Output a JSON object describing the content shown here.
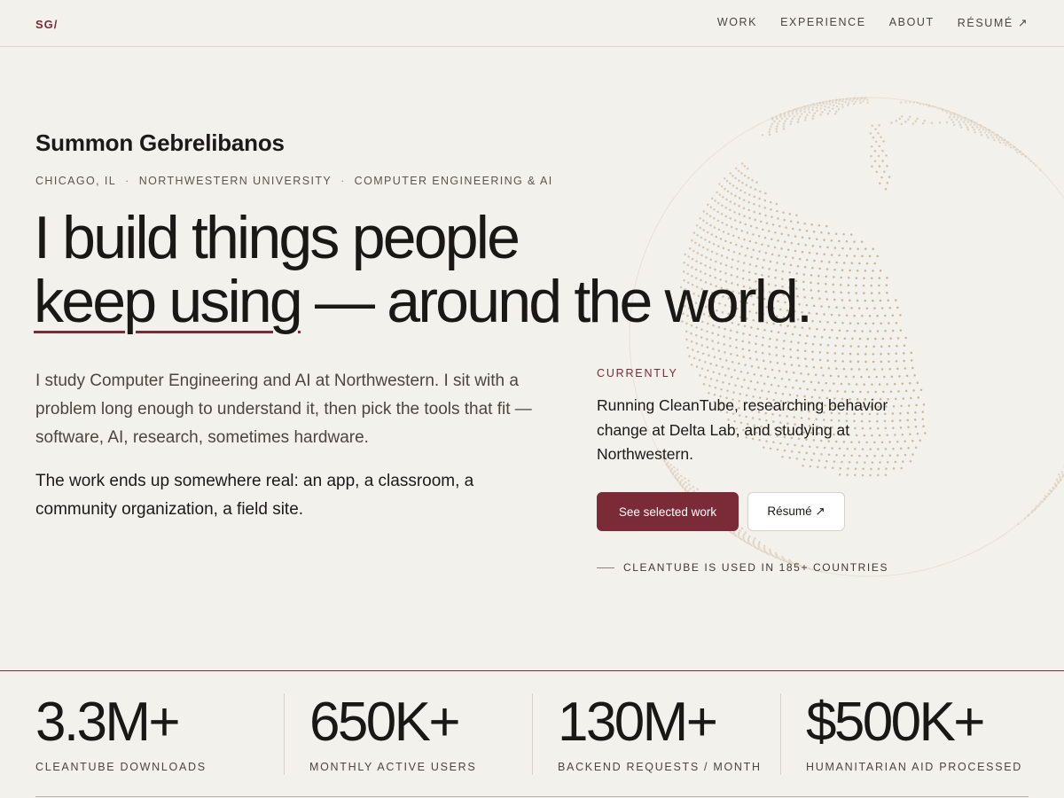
{
  "header": {
    "logo": "SG/",
    "nav": [
      {
        "label": "WORK"
      },
      {
        "label": "EXPERIENCE"
      },
      {
        "label": "ABOUT"
      },
      {
        "label": "RÉSUMÉ ↗"
      }
    ]
  },
  "hero": {
    "name": "Summon Gebrelibanos",
    "meta": [
      "CHICAGO, IL",
      "NORTHWESTERN UNIVERSITY",
      "COMPUTER ENGINEERING & AI"
    ],
    "meta_separator": "·",
    "headline_line1": "I build things people",
    "headline_underlined": "keep using",
    "headline_rest": " — around the world.",
    "intro": "I study Computer Engineering and AI at Northwestern. I sit with a problem long enough to understand it, then pick the tools that fit — software, AI, research, sometimes hardware.",
    "intro2": "The work ends up somewhere real: an app, a classroom, a community organization, a field site."
  },
  "currently": {
    "label": "CURRENTLY",
    "text": "Running CleanTube, researching behavior change at Delta Lab, and studying at Northwestern.",
    "primary_button": "See selected work",
    "secondary_button": "Résumé ↗",
    "footnote": "CLEANTUBE IS USED IN 185+ COUNTRIES"
  },
  "stats": [
    {
      "value": "3.3M+",
      "label": "CLEANTUBE DOWNLOADS"
    },
    {
      "value": "650K+",
      "label": "MONTHLY ACTIVE USERS"
    },
    {
      "value": "130M+",
      "label": "BACKEND REQUESTS / MONTH"
    },
    {
      "value": "$500K+",
      "label": "HUMANITARIAN AID PROCESSED"
    }
  ],
  "colors": {
    "accent": "#7b2a38",
    "background": "#f3f1ec",
    "globe_dots": "#c4ae92"
  },
  "icons": {
    "globe": "dotted-globe-icon",
    "external_link": "arrow-up-right-icon"
  }
}
